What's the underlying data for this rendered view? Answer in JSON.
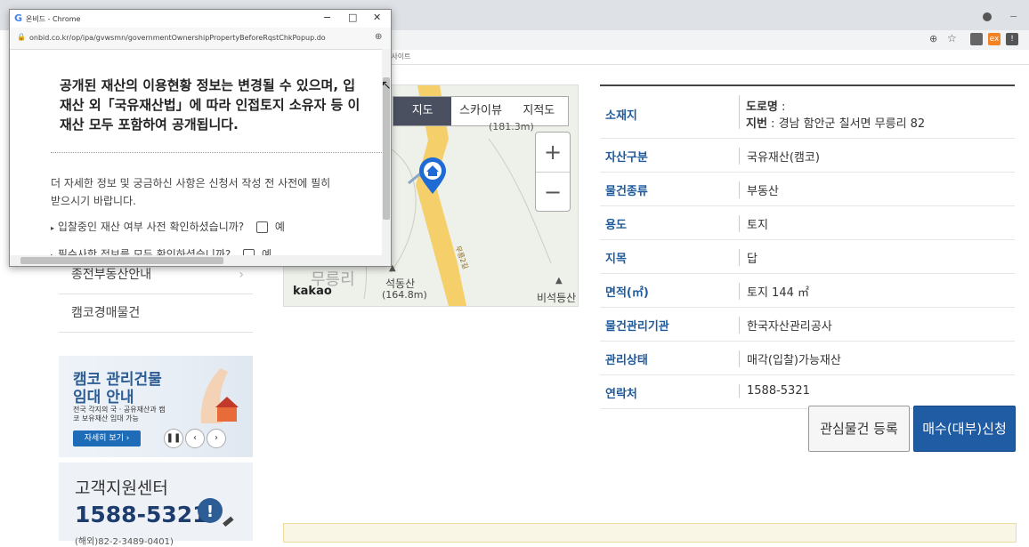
{
  "browser": {
    "bookmark_text": "요사이트"
  },
  "popup": {
    "window_title": "온비드 - Chrome",
    "url": "onbid.co.kr/op/ipa/gvwsmn/governmentOwnershipPropertyBeforeRqstChkPopup.do",
    "heading_lines": [
      "공개된 재산의 이용현황 정보는 변경될 수 있으며, 입",
      "재산 외「국유재산법」에 따라 인접토지 소유자 등 이",
      "재산 모두 포함하여 공개됩니다."
    ],
    "detail_lines": [
      "더 자세한 정보 및 궁금하신 사항은 신청서 작성 전 사전에 필히 ",
      "받으시기 바랍니다."
    ],
    "check_items": [
      {
        "question": "입찰중인 재산 여부 사전 확인하셨습니까?",
        "label": "예"
      },
      {
        "question": "필수사항 정보를 모두 확인하셨습니까?",
        "label": "예"
      }
    ]
  },
  "side_menu": {
    "items": [
      "종전부동산안내",
      "캠코경매물건"
    ]
  },
  "banner": {
    "title_line1": "캠코 관리건물",
    "title_line2": "임대 안내",
    "desc": "전국 각지의 국 · 공유재산과 캠코 보유재산 임대 가능",
    "button": "자세히 보기 ›"
  },
  "customer_center": {
    "title": "고객지원센터",
    "phone": "1588-5321",
    "sub": "(해외)82-2-3489-0401)"
  },
  "map": {
    "tabs": [
      "지도",
      "스카이뷰",
      "지적도"
    ],
    "active_tab": "지도",
    "zoom_in": "+",
    "zoom_out": "−",
    "labels": {
      "top_elev": "(181.3m)",
      "place_big": "무릉리",
      "peak_name": "석동산",
      "peak_elev": "(164.8m)",
      "right_place": "비석등산",
      "road": "무릉2길",
      "logo": "kakao"
    }
  },
  "property": {
    "rows": [
      {
        "key": "소재지",
        "road_label": "도로명",
        "road_value": " :",
        "lot_label": "지번",
        "lot_value": " : 경남 함안군 칠서면 무릉리 82"
      },
      {
        "key": "자산구분",
        "value": "국유재산(캠코)"
      },
      {
        "key": "물건종류",
        "value": "부동산"
      },
      {
        "key": "용도",
        "value": "토지"
      },
      {
        "key": "지목",
        "value": "답"
      },
      {
        "key": "면적(㎡)",
        "value": "토지 144 ㎡"
      },
      {
        "key": "물건관리기관",
        "value": "한국자산관리공사"
      },
      {
        "key": "관리상태",
        "value": "매각(입찰)가능재산"
      },
      {
        "key": "연락처",
        "value": "1588-5321"
      }
    ]
  },
  "actions": {
    "interest": "관심물건 등록",
    "apply": "매수(대부)신청"
  }
}
